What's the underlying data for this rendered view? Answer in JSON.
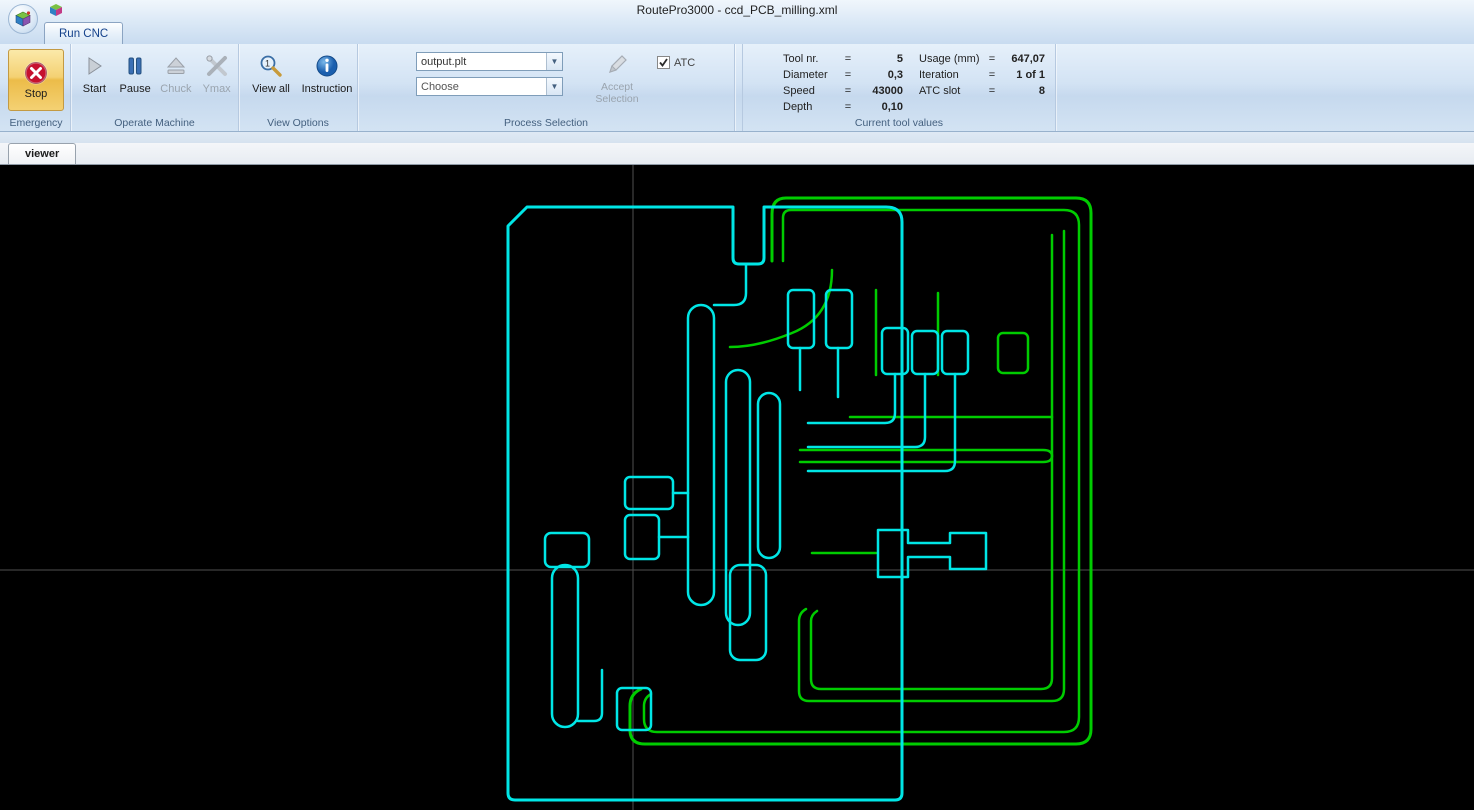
{
  "window": {
    "title": "RoutePro3000 - ccd_PCB_milling.xml"
  },
  "ribbon": {
    "tab_label": "Run CNC",
    "emergency": {
      "group_label": "Emergency",
      "stop_label": "Stop"
    },
    "operate": {
      "group_label": "Operate Machine",
      "start_label": "Start",
      "pause_label": "Pause",
      "chuck_label": "Chuck",
      "ymax_label": "Ymax"
    },
    "view": {
      "group_label": "View Options",
      "view_all_label": "View all",
      "instruction_label": "Instruction"
    },
    "process": {
      "group_label": "Process Selection",
      "dropdown_output": "output.plt",
      "dropdown_choose": "Choose",
      "accept_line1": "Accept",
      "accept_line2": "Selection",
      "atc_label": "ATC",
      "atc_checked": true
    },
    "tool": {
      "group_label": "Current tool values",
      "left_rows": [
        {
          "name": "Tool nr.",
          "eq": "=",
          "value": "5"
        },
        {
          "name": "Diameter",
          "eq": "=",
          "value": "0,3"
        },
        {
          "name": "Speed",
          "eq": "=",
          "value": "43000"
        },
        {
          "name": "Depth",
          "eq": "=",
          "value": "0,10"
        }
      ],
      "right_rows": [
        {
          "name": "Usage (mm)",
          "eq": "=",
          "value": "647,07"
        },
        {
          "name": "Iteration",
          "eq": "=",
          "value": "1 of 1"
        },
        {
          "name": "ATC slot",
          "eq": "=",
          "value": "8"
        }
      ]
    }
  },
  "viewer": {
    "tab_label": "viewer"
  },
  "colors": {
    "trace_cyan": "#00e6e6",
    "trace_green": "#00cc00",
    "canvas_background": "#000000",
    "crosshair": "#4f4f4f"
  }
}
